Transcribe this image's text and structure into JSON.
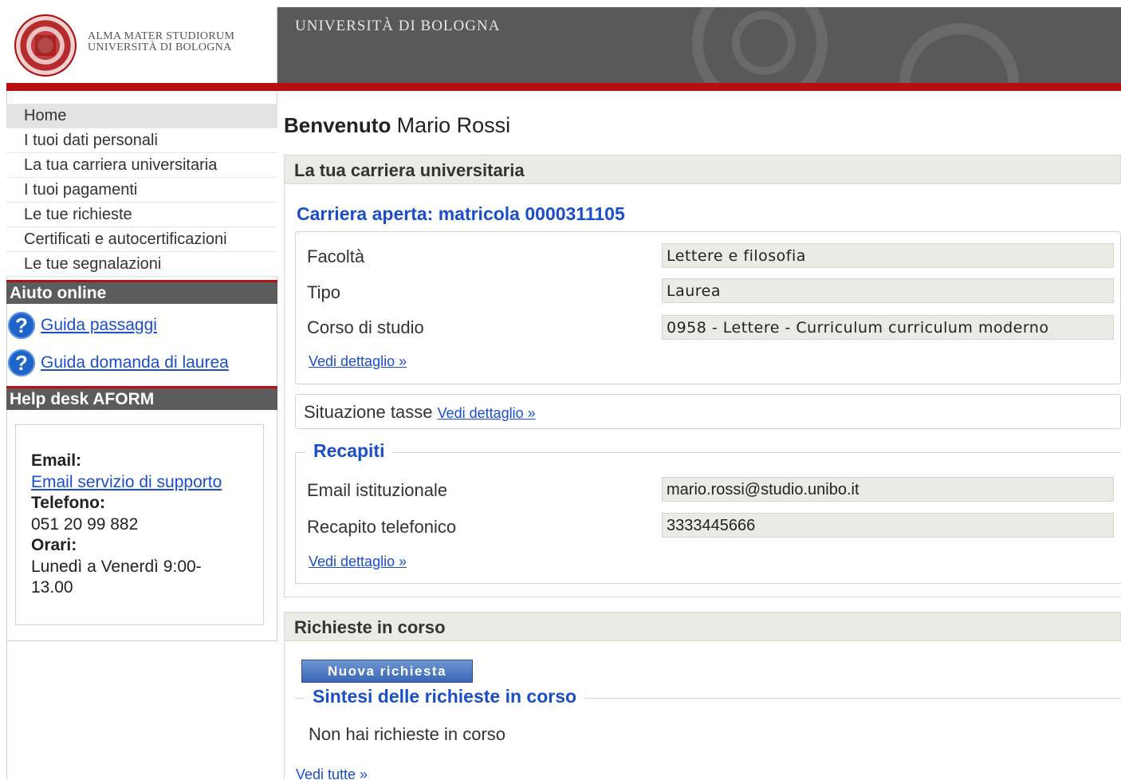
{
  "header": {
    "logo_line1": "ALMA MATER STUDIORUM",
    "logo_line2": "UNIVERSITÀ DI BOLOGNA",
    "banner_title": "UNIVERSITÀ DI BOLOGNA"
  },
  "sidebar": {
    "nav": [
      {
        "label": "Home",
        "active": true
      },
      {
        "label": "I tuoi dati personali"
      },
      {
        "label": "La tua carriera universitaria"
      },
      {
        "label": "I tuoi pagamenti"
      },
      {
        "label": "Le tue richieste"
      },
      {
        "label": "Certificati e autocertificazioni"
      },
      {
        "label": "Le tue segnalazioni"
      }
    ],
    "help_title": "Aiuto online",
    "help_links": [
      "Guida passaggi",
      "Guida domanda di laurea"
    ],
    "helpdesk_title": "Help desk AFORM",
    "contact": {
      "email_label": "Email:",
      "email_link": "Email servizio di supporto",
      "phone_label": "Telefono:",
      "phone": "051 20 99 882",
      "hours_label": "Orari:",
      "hours": "Lunedì a Venerdì 9:00-13.00"
    }
  },
  "main": {
    "welcome_prefix": "Benvenuto",
    "user_name": "Mario Rossi",
    "career_panel_title": "La tua carriera universitaria",
    "career_title": "Carriera aperta: matricola 0000311105",
    "career_rows": [
      {
        "label": "Facoltà",
        "value": "Lettere e filosofia"
      },
      {
        "label": "Tipo",
        "value": "Laurea"
      },
      {
        "label": "Corso di studio",
        "value": "0958 - Lettere - Curriculum curriculum moderno"
      }
    ],
    "detail_link": "Vedi dettaglio »",
    "taxes_label": "Situazione tasse",
    "contacts_legend": "Recapiti",
    "contact_rows": [
      {
        "label": "Email istituzionale",
        "value": "mario.rossi@studio.unibo.it"
      },
      {
        "label": "Recapito telefonico",
        "value": "3333445666"
      }
    ],
    "requests_panel_title": "Richieste in corso",
    "new_request_button": "Nuova richiesta",
    "requests_legend": "Sintesi delle richieste in corso",
    "no_requests": "Non hai richieste in corso",
    "see_all": "Vedi tutte »"
  }
}
